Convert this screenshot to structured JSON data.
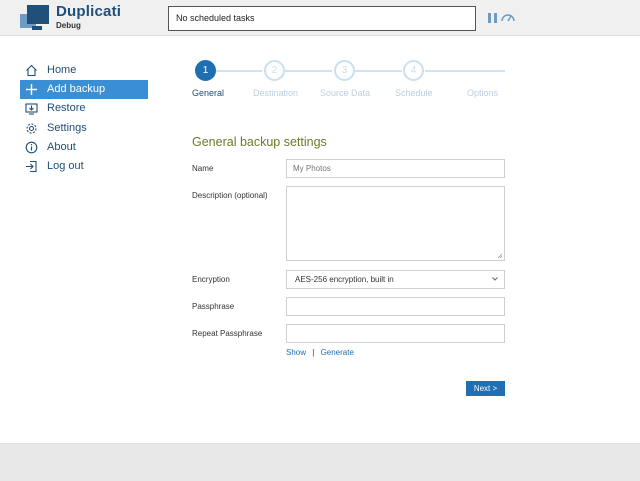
{
  "header": {
    "brand": "Duplicati",
    "brand_sub": "Debug",
    "status_text": "No scheduled tasks",
    "pause_icon": "pause-icon",
    "throttle_icon": "speedometer-icon"
  },
  "sidebar": {
    "items": [
      {
        "label": "Home",
        "icon": "home-icon",
        "active": false
      },
      {
        "label": "Add backup",
        "icon": "plus-icon",
        "active": true
      },
      {
        "label": "Restore",
        "icon": "restore-icon",
        "active": false
      },
      {
        "label": "Settings",
        "icon": "gear-icon",
        "active": false
      },
      {
        "label": "About",
        "icon": "info-icon",
        "active": false
      },
      {
        "label": "Log out",
        "icon": "logout-icon",
        "active": false
      }
    ]
  },
  "wizard": {
    "steps": [
      {
        "number": "1",
        "label": "General",
        "active": true
      },
      {
        "number": "2",
        "label": "Destination",
        "active": false
      },
      {
        "number": "3",
        "label": "Source Data",
        "active": false
      },
      {
        "number": "4",
        "label": "Schedule",
        "active": false
      },
      {
        "number": "",
        "label": "Options",
        "active": false
      }
    ]
  },
  "form": {
    "title": "General backup settings",
    "name_label": "Name",
    "name_placeholder": "My Photos",
    "description_label": "Description (optional)",
    "encryption_label": "Encryption",
    "encryption_value": "AES-256 encryption, built in",
    "passphrase_label": "Passphrase",
    "repeat_passphrase_label": "Repeat Passphrase",
    "show_link": "Show",
    "separator": "|",
    "generate_link": "Generate",
    "next_button": "Next >"
  },
  "colors": {
    "accent": "#1f6fb2",
    "active_nav": "#3a8fd4",
    "title_olive": "#6b7a2b",
    "brand_blue": "#1f4e79"
  }
}
